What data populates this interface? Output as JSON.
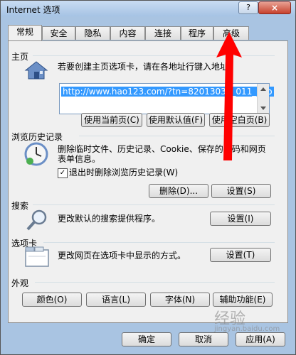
{
  "window": {
    "title": "Internet 选项",
    "help_label": "?",
    "close_label": "×"
  },
  "tabs": [
    "常规",
    "安全",
    "隐私",
    "内容",
    "连接",
    "程序",
    "高级"
  ],
  "home": {
    "group_label": "主页",
    "description": "若要创建主页选项卡，请在各地址行键入地址",
    "description_tail": "。",
    "url": "http://www.hao123.com/?tn=82013038_011_hao",
    "buttons": [
      "使用当前页(C)",
      "使用默认值(F)",
      "使用空白页(B)"
    ]
  },
  "history": {
    "group_label": "浏览历史记录",
    "description_line1": "删除临时文件、历史记录、Cookie、保存的密码和网页",
    "description_line2": "表单信息。",
    "checkbox_label": "退出时删除浏览历史记录(W)",
    "checkbox_checked": true,
    "delete_label": "删除(D)...",
    "settings_label": "设置(S)"
  },
  "search": {
    "group_label": "搜索",
    "description": "更改默认的搜索提供程序。",
    "settings_label": "设置(I)"
  },
  "tabsection": {
    "group_label": "选项卡",
    "description": "更改网页在选项卡中显示的方式。",
    "settings_label": "设置(T)"
  },
  "appearance": {
    "group_label": "外观",
    "buttons": [
      "颜色(O)",
      "语言(L)",
      "字体(N)",
      "辅助功能(E)"
    ]
  },
  "footer": {
    "ok_label": "确定",
    "cancel_label": "取消",
    "apply_label": "应用(A)"
  },
  "watermark": {
    "text": "经验",
    "subtext": "jingyan.baidu.com"
  },
  "colors": {
    "arrow": "#ff0000",
    "selection": "#3399ff",
    "titlebar": "#a6c3e4"
  }
}
